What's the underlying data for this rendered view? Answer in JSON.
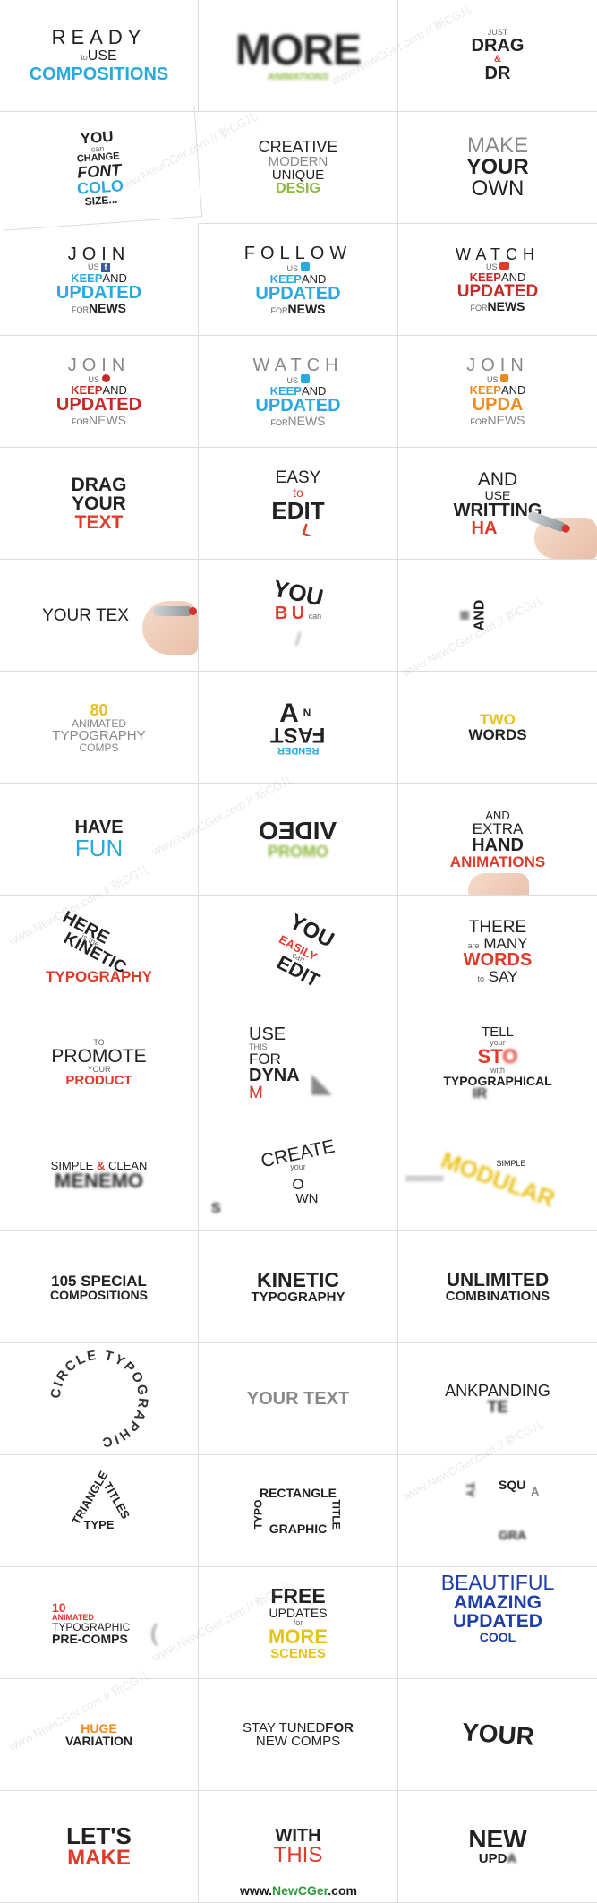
{
  "cells": {
    "c01": {
      "l1": "READY",
      "l2": "to",
      "l3": "USE",
      "l4": "COMPOSITIONS"
    },
    "c02": {
      "l1": "MORE",
      "l2": "ANIMATIONS"
    },
    "c03": {
      "l1": "JUST",
      "l2": "DRAG",
      "l3": "&",
      "l4": "DR"
    },
    "c04": {
      "l1": "YOU",
      "l2": "can",
      "l3": "CHANGE",
      "l4": "FONT",
      "l5": "COLO",
      "l6": "SIZE..."
    },
    "c05": {
      "l1": "CREATIVE",
      "l2": "MODERN",
      "l3": "UNIQUE",
      "l4": "DESIG"
    },
    "c06": {
      "l1": "MAKE",
      "l2": "YOUR",
      "l3": "OWN"
    },
    "c07": {
      "l1": "JOIN",
      "l2": "US",
      "l3": "KEEP",
      "l4": "AND",
      "l5": "UPDATED",
      "l6": "FOR",
      "l7": "NEWS"
    },
    "c08": {
      "l1": "FOLLOW",
      "l2": "US",
      "l3": "KEEP",
      "l4": "AND",
      "l5": "UPDATED",
      "l6": "FOR",
      "l7": "NEWS"
    },
    "c09": {
      "l1": "WATCH",
      "l2": "US",
      "l3": "KEEP",
      "l4": "AND",
      "l5": "UPDATED",
      "l6": "FOR",
      "l7": "NEWS"
    },
    "c10": {
      "l1": "JOIN",
      "l2": "US",
      "l3": "KEEP",
      "l4": "AND",
      "l5": "UPDATED",
      "l6": "FOR",
      "l7": "NEWS"
    },
    "c11": {
      "l1": "WATCH",
      "l2": "US",
      "l3": "KEEP",
      "l4": "AND",
      "l5": "UPDATED",
      "l6": "FOR",
      "l7": "NEWS"
    },
    "c12": {
      "l1": "JOIN",
      "l2": "US",
      "l3": "KEEP",
      "l4": "AND",
      "l5": "UPDA",
      "l6": "FOR",
      "l7": "NEWS"
    },
    "c13": {
      "l1": "DRAG",
      "l2": "YOUR",
      "l3": "TEXT"
    },
    "c14": {
      "l1": "EASY",
      "l2": "to",
      "l3": "EDIT",
      "l4": "L"
    },
    "c15": {
      "l1": "AND",
      "l2": "USE",
      "l3": "WRITTING",
      "l4": "HA"
    },
    "c16": {
      "l1": "YOUR TEX"
    },
    "c17": {
      "l1": "YOU",
      "l2": "B",
      "l3": "U",
      "l4": "can"
    },
    "c18": {
      "l1": "AND"
    },
    "c19": {
      "l1": "80",
      "l2": "ANIMATED",
      "l3": "TYPOGRAPHY",
      "l4": "COMPS"
    },
    "c20": {
      "l1": "A",
      "l2": "N",
      "l3": "FAST",
      "l4": "RENDER"
    },
    "c21": {
      "l1": "TWO",
      "l2": "WORDS"
    },
    "c22": {
      "l1": "HAVE",
      "l2": "FUN"
    },
    "c23": {
      "l1": "VIDEO",
      "l2": "PROMO"
    },
    "c24": {
      "l1": "AND",
      "l2": "EXTRA",
      "l3": "HAND",
      "l4": "ANIMATIONS"
    },
    "c25": {
      "l1": "HERE",
      "l2": "is the",
      "l3": "KINETIC",
      "l4": "TYPOGRAPHY"
    },
    "c26": {
      "l1": "YOU",
      "l2": "EASILY",
      "l3": "can",
      "l4": "EDIT"
    },
    "c27": {
      "l1": "THERE",
      "l2": "are",
      "l3": "MANY",
      "l4": "WORDS",
      "l5": "to",
      "l6": "SAY"
    },
    "c28": {
      "l1": "TO",
      "l2": "PROMOTE",
      "l3": "YOUR",
      "l4": "PRODUCT"
    },
    "c29": {
      "l1": "USE",
      "l2": "THIS",
      "l3": "FOR",
      "l4": "DYNA",
      "l5": "M"
    },
    "c30": {
      "l1": "TELL",
      "l2": "your",
      "l3": "ST",
      "l4": "O",
      "l5": "with",
      "l6": "TYPOGRAPHICAL",
      "l7": "IR"
    },
    "c31": {
      "l1": "SIMPLE",
      "l2": "&",
      "l3": "CLEAN",
      "l4": "MENEMO"
    },
    "c32": {
      "l1": "CREATE",
      "l2": "your",
      "l3": "O",
      "l4": "WN",
      "l5": "S"
    },
    "c33": {
      "l1": "SIMPLE",
      "l2": "MODULAR"
    },
    "c34": {
      "l1": "105 SPECIAL",
      "l2": "COMPOSITIONS"
    },
    "c35": {
      "l1": "KINETIC",
      "l2": "TYPOGRAPHY"
    },
    "c36": {
      "l1": "UNLIMITED",
      "l2": "COMBINATIONS"
    },
    "c37": {
      "l1": "CIRCLE TYPOGRAPHIC"
    },
    "c38": {
      "l1": "YOUR TEXT"
    },
    "c39": {
      "l1": "ANKPANDING",
      "l2": "TE"
    },
    "c40": {
      "l1": "TRIANGLE",
      "l2": "TITLES",
      "l3": "TYPE"
    },
    "c41": {
      "l1": "RECTANGLE",
      "l2": "TITLE",
      "l3": "GRAPHIC",
      "l4": "TYPO"
    },
    "c42": {
      "l1": "TY",
      "l2": "SQU",
      "l3": "A",
      "l4": "GRA"
    },
    "c43": {
      "l1": "10",
      "l2": "ANIMATED",
      "l3": "TYPOGRAPHIC",
      "l4": "PRE-COMPS"
    },
    "c44": {
      "l1": "FREE",
      "l2": "UPDATES",
      "l3": "for",
      "l4": "MORE",
      "l5": "SCENES"
    },
    "c45": {
      "l1": "BEAUTIFUL",
      "l2": "AMAZING",
      "l3": "UPDATED",
      "l4": "COOL"
    },
    "c46": {
      "l1": "HUGE",
      "l2": "VARIATION"
    },
    "c47": {
      "l1": "STAY TUNED",
      "l2": "FOR",
      "l3": "NEW COMPS"
    },
    "c48": {
      "l1": "YOUR"
    },
    "c49": {
      "l1": "LET'S",
      "l2": "MAKE"
    },
    "c50": {
      "l1": "WITH",
      "l2": "THIS"
    },
    "c51": {
      "l1": "NEW",
      "l2": "UPD",
      "l3": "A"
    }
  },
  "watermark": "www.NewCGer.com // 新CG儿",
  "credit": {
    "pre": "www.",
    "brand": "NewCGer",
    "post": ".com"
  }
}
